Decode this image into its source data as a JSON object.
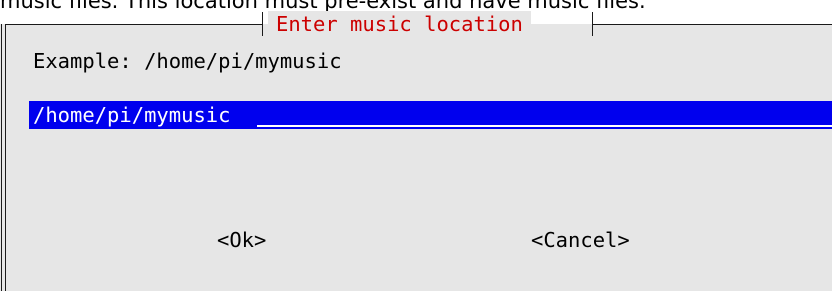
{
  "intro": {
    "text": "music files. This location must pre-exist and have music files."
  },
  "dialog": {
    "title": "Enter music location",
    "example": "Example: /home/pi/mymusic",
    "input": {
      "value": "/home/pi/mymusic"
    },
    "buttons": {
      "ok": "<Ok>",
      "cancel": "<Cancel>"
    }
  },
  "colors": {
    "dialog_bg": "#e6e6e6",
    "title_text": "#cc0000",
    "input_bg": "#0000ee",
    "input_text": "#ffffff"
  }
}
